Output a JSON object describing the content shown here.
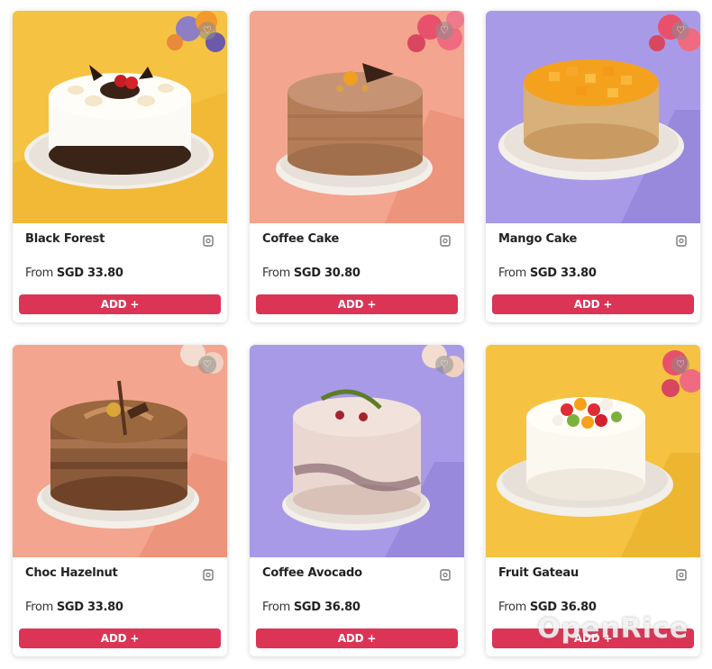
{
  "products": [
    {
      "name": "Black Forest",
      "from_label": "From",
      "price": "SGD 33.80",
      "add_label": "ADD +",
      "background": "#f6c241",
      "image": "black-forest-cake"
    },
    {
      "name": "Coffee Cake",
      "from_label": "From",
      "price": "SGD 30.80",
      "add_label": "ADD +",
      "background": "#f4a58f",
      "image": "coffee-cake"
    },
    {
      "name": "Mango Cake",
      "from_label": "From",
      "price": "SGD 33.80",
      "add_label": "ADD +",
      "background": "#a99ae8",
      "image": "mango-cake"
    },
    {
      "name": "Choc Hazelnut",
      "from_label": "From",
      "price": "SGD 33.80",
      "add_label": "ADD +",
      "background": "#f4a58f",
      "image": "choc-hazelnut-cake"
    },
    {
      "name": "Coffee Avocado",
      "from_label": "From",
      "price": "SGD 36.80",
      "add_label": "ADD +",
      "background": "#a99ae8",
      "image": "coffee-avocado-cake"
    },
    {
      "name": "Fruit Gateau",
      "from_label": "From",
      "price": "SGD 36.80",
      "add_label": "ADD +",
      "background": "#f6c241",
      "image": "fruit-gateau-cake"
    }
  ],
  "colors": {
    "accent": "#dc3455",
    "text": "#222222"
  },
  "icons": {
    "favorite": "heart-icon",
    "share": "share-icon"
  },
  "watermark": "OpenRice"
}
